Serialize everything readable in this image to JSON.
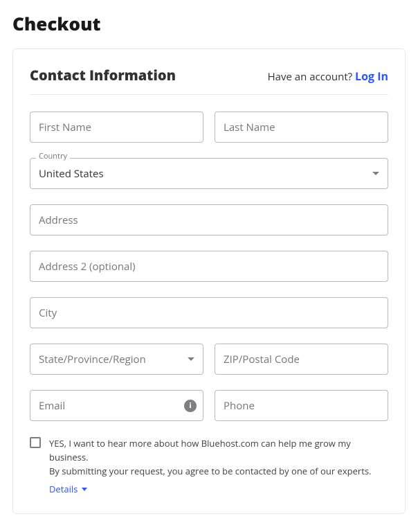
{
  "page": {
    "title": "Checkout"
  },
  "contact": {
    "section_title": "Contact Information",
    "account_q": "Have an account? ",
    "login_label": "Log In",
    "first_name_placeholder": "First Name",
    "last_name_placeholder": "Last Name",
    "country_label": "Country",
    "country_value": "United States",
    "address_placeholder": "Address",
    "address2_placeholder": "Address 2 (optional)",
    "city_placeholder": "City",
    "state_placeholder": "State/Province/Region",
    "zip_placeholder": "ZIP/Postal Code",
    "email_placeholder": "Email",
    "phone_placeholder": "Phone",
    "optin_text_1": "YES, I want to hear more about how Bluehost.com can help me grow my business.",
    "optin_text_2": "By submitting your request, you agree to be contacted by one of our experts.",
    "details_label": "Details"
  }
}
